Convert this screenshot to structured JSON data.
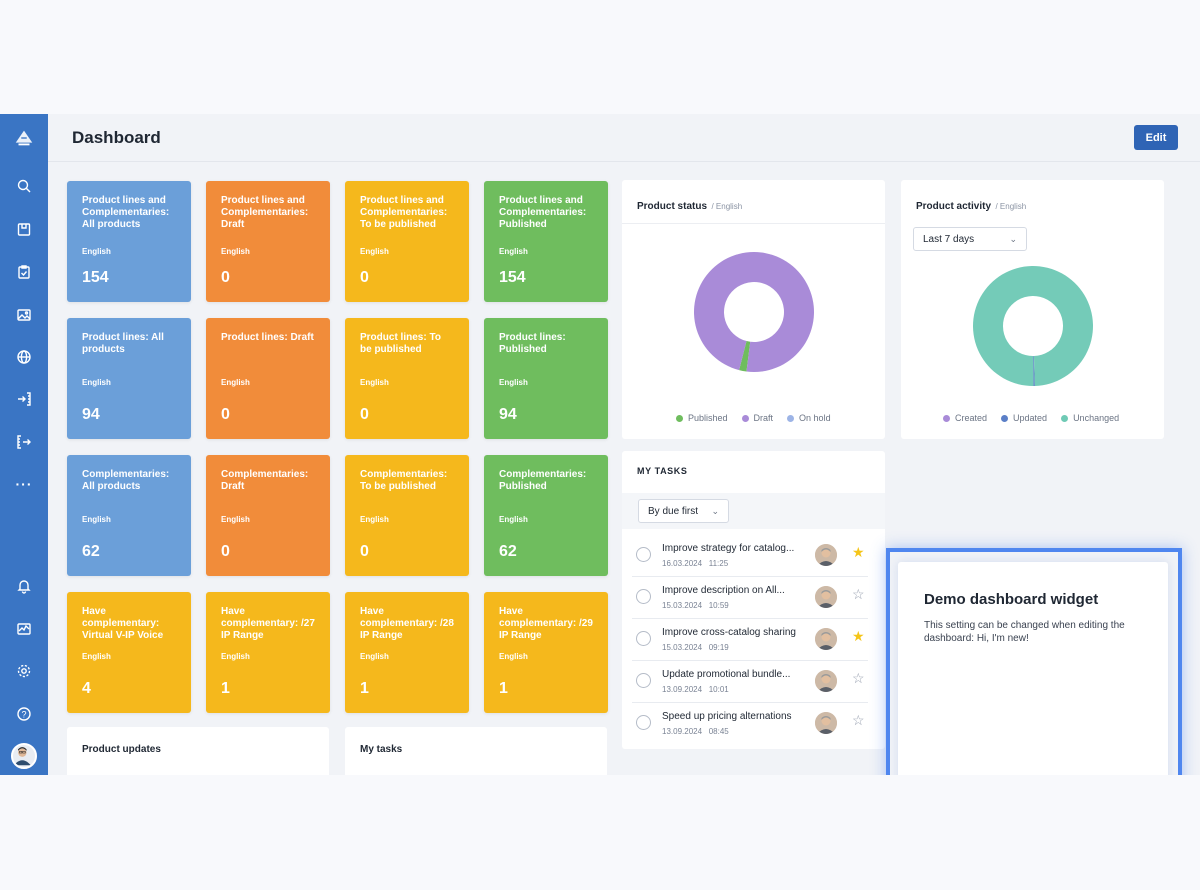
{
  "header": {
    "title": "Dashboard",
    "edit_label": "Edit"
  },
  "sidebar": {
    "icons": [
      "logo-icon",
      "search-icon",
      "product-box-icon",
      "clipboard-icon",
      "image-icon",
      "globe-icon",
      "import-icon",
      "export-icon",
      "more-icon",
      "bell-icon",
      "activity-icon",
      "gear-icon",
      "help-icon"
    ],
    "more_label": "···",
    "help_label": "?"
  },
  "tiles": [
    {
      "title": "Product lines and Complementaries: All products",
      "lang": "English",
      "value": "154",
      "color": "blue"
    },
    {
      "title": "Product lines and Complementaries: Draft",
      "lang": "English",
      "value": "0",
      "color": "orange"
    },
    {
      "title": "Product lines and Complementaries: To be published",
      "lang": "English",
      "value": "0",
      "color": "yellow"
    },
    {
      "title": "Product lines and Complementaries: Published",
      "lang": "English",
      "value": "154",
      "color": "green"
    },
    {
      "title": "Product lines: All products",
      "lang": "English",
      "value": "94",
      "color": "blue"
    },
    {
      "title": "Product lines: Draft",
      "lang": "English",
      "value": "0",
      "color": "orange"
    },
    {
      "title": "Product lines: To be published",
      "lang": "English",
      "value": "0",
      "color": "yellow"
    },
    {
      "title": "Product lines: Published",
      "lang": "English",
      "value": "94",
      "color": "green"
    },
    {
      "title": "Complementaries: All products",
      "lang": "English",
      "value": "62",
      "color": "blue"
    },
    {
      "title": "Complementaries: Draft",
      "lang": "English",
      "value": "0",
      "color": "orange"
    },
    {
      "title": "Complementaries: To be published",
      "lang": "English",
      "value": "0",
      "color": "yellow"
    },
    {
      "title": "Complementaries: Published",
      "lang": "English",
      "value": "62",
      "color": "green"
    },
    {
      "title": "Have complementary: Virtual V-IP Voice",
      "lang": "English",
      "value": "4",
      "color": "yellow"
    },
    {
      "title": "Have complementary: /27 IP Range",
      "lang": "English",
      "value": "1",
      "color": "yellow"
    },
    {
      "title": "Have complementary: /28 IP Range",
      "lang": "English",
      "value": "1",
      "color": "yellow"
    },
    {
      "title": "Have complementary: /29 IP Range",
      "lang": "English",
      "value": "1",
      "color": "yellow"
    }
  ],
  "product_status": {
    "title": "Product status",
    "sub": "/ English",
    "legend": [
      {
        "label": "Published",
        "color": "#6fbd5e"
      },
      {
        "label": "Draft",
        "color": "#a98bd8"
      },
      {
        "label": "On hold",
        "color": "#9db4e6"
      }
    ],
    "slices": [
      {
        "label": "Published",
        "fraction": 0.02,
        "color": "#6fbd5e"
      },
      {
        "label": "Draft",
        "fraction": 0.98,
        "color": "#a98bd8"
      }
    ]
  },
  "product_activity": {
    "title": "Product activity",
    "sub": "/ English",
    "range_label": "Last 7 days",
    "legend": [
      {
        "label": "Created",
        "color": "#a98bd8"
      },
      {
        "label": "Updated",
        "color": "#5b7fc7"
      },
      {
        "label": "Unchanged",
        "color": "#6fcab5"
      }
    ],
    "slices": [
      {
        "label": "Updated",
        "fraction": 0.004,
        "color": "#5b7fc7"
      },
      {
        "label": "Unchanged",
        "fraction": 0.996,
        "color": "#74cbb8"
      }
    ]
  },
  "my_tasks": {
    "title": "MY TASKS",
    "sort_label": "By due first",
    "tasks": [
      {
        "name": "Improve strategy for catalog...",
        "date": "16.03.2024",
        "time": "11:25",
        "starred": true
      },
      {
        "name": "Improve description on All...",
        "date": "15.03.2024",
        "time": "10:59",
        "starred": false
      },
      {
        "name": "Improve cross-catalog sharing",
        "date": "15.03.2024",
        "time": "09:19",
        "starred": true
      },
      {
        "name": "Update promotional bundle...",
        "date": "13.09.2024",
        "time": "10:01",
        "starred": false
      },
      {
        "name": "Speed up pricing alternations",
        "date": "13.09.2024",
        "time": "08:45",
        "starred": false
      }
    ]
  },
  "bottom_cards": {
    "product_updates": "Product updates",
    "my_tasks": "My tasks"
  },
  "demo_widget": {
    "title": "Demo dashboard widget",
    "body": "This setting can be changed when editing the dashboard: Hi, I'm new!"
  },
  "colors": {
    "blue": "#6b9fd9",
    "orange": "#f18c3a",
    "yellow": "#f5b81c",
    "green": "#6fbd5e",
    "accent": "#2f64b5",
    "highlight": "#4f86ef",
    "star_on": "#f5c518",
    "star_off": "#9aa2b1"
  }
}
